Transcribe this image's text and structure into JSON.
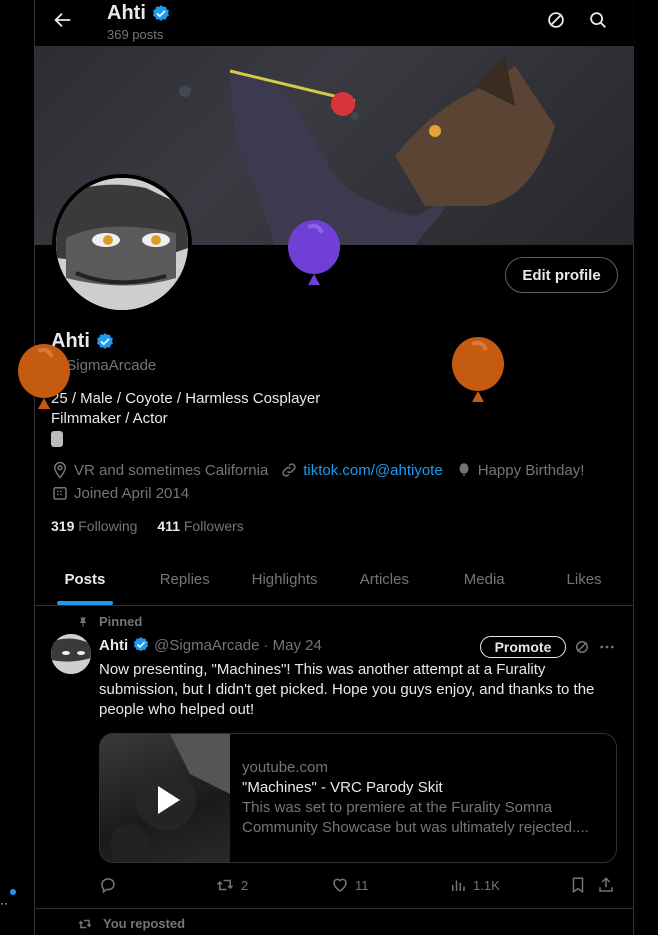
{
  "header": {
    "name": "Ahti",
    "posts_count": "369 posts"
  },
  "profile": {
    "name": "Ahti",
    "handle": "@SigmaArcade",
    "bio_line1": "25 / Male / Coyote / Harmless Cosplayer",
    "bio_line2": "Filmmaker / Actor",
    "location": "VR and sometimes California",
    "link": "tiktok.com/@ahtiyote",
    "birthday": "Happy Birthday!",
    "joined": "Joined April 2014",
    "following_count": "319",
    "following_label": "Following",
    "followers_count": "411",
    "followers_label": "Followers",
    "edit_label": "Edit profile"
  },
  "tabs": [
    {
      "label": "Posts"
    },
    {
      "label": "Replies"
    },
    {
      "label": "Highlights"
    },
    {
      "label": "Articles"
    },
    {
      "label": "Media"
    },
    {
      "label": "Likes"
    }
  ],
  "pinned_tweet": {
    "pinned_label": "Pinned",
    "author": "Ahti",
    "handle": "@SigmaArcade",
    "date": "· May 24",
    "promote_label": "Promote",
    "text": "Now presenting, \"Machines\"! This was another attempt at a Furality submission, but I didn't get picked. Hope you guys enjoy, and thanks to the people who helped out!",
    "card": {
      "domain": "youtube.com",
      "title": "\"Machines\" - VRC Parody Skit",
      "desc1": "This was set to premiere at the Furality Somna",
      "desc2": "Community Showcase but was ultimately rejected...."
    },
    "stats": {
      "reposts": "2",
      "likes": "11",
      "views": "1.1K"
    }
  },
  "next": {
    "reposted_label": "You reposted"
  },
  "colors": {
    "accent": "#1d9bf0",
    "balloon_purple": "#6f3fd6",
    "balloon_orange": "#c55a11"
  }
}
